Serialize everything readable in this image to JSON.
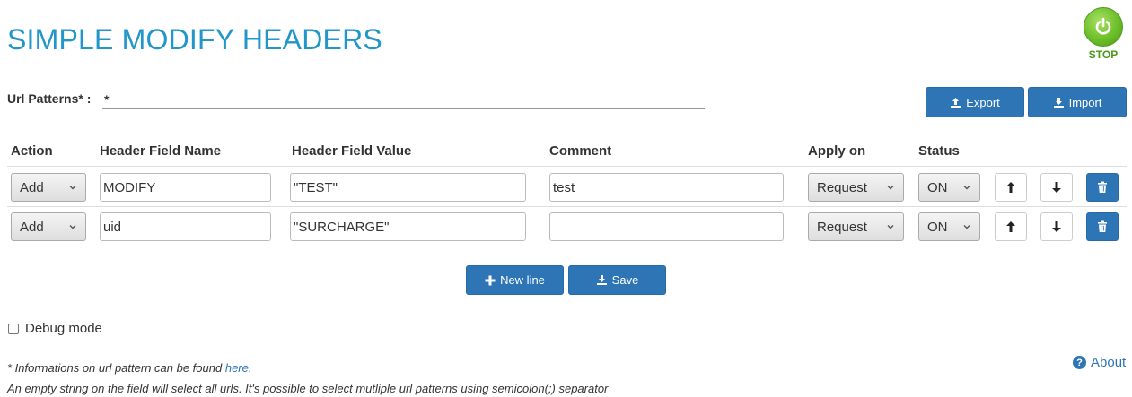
{
  "app": {
    "title": "SIMPLE MODIFY HEADERS",
    "stop_label": "STOP",
    "accent_color": "#2196c9",
    "button_color": "#2e75b6",
    "stop_color": "#6cbf2a"
  },
  "url": {
    "label": "Url Patterns* :",
    "value": "*"
  },
  "toolbar": {
    "export_label": "Export",
    "import_label": "Import",
    "export_icon": "upload-icon",
    "import_icon": "download-icon"
  },
  "table": {
    "headers": {
      "action": "Action",
      "name": "Header Field Name",
      "value": "Header Field Value",
      "comment": "Comment",
      "apply": "Apply on",
      "status": "Status"
    },
    "rows": [
      {
        "action": "Add",
        "name": "MODIFY",
        "value": "\"TEST\"",
        "comment": "test",
        "apply": "Request",
        "status": "ON"
      },
      {
        "action": "Add",
        "name": "uid",
        "value": "\"SURCHARGE\"",
        "comment": "",
        "apply": "Request",
        "status": "ON"
      }
    ]
  },
  "actions": {
    "new_line_label": "New line",
    "save_label": "Save"
  },
  "debug": {
    "label": "Debug mode",
    "checked": false
  },
  "about": {
    "label": "About"
  },
  "notes": {
    "line1_prefix": "* Informations on url pattern can be found",
    "line1_link": "here.",
    "line2": "An empty string on the field will select all urls. It's possible to select mutliple url patterns using semicolon(;) separator"
  }
}
